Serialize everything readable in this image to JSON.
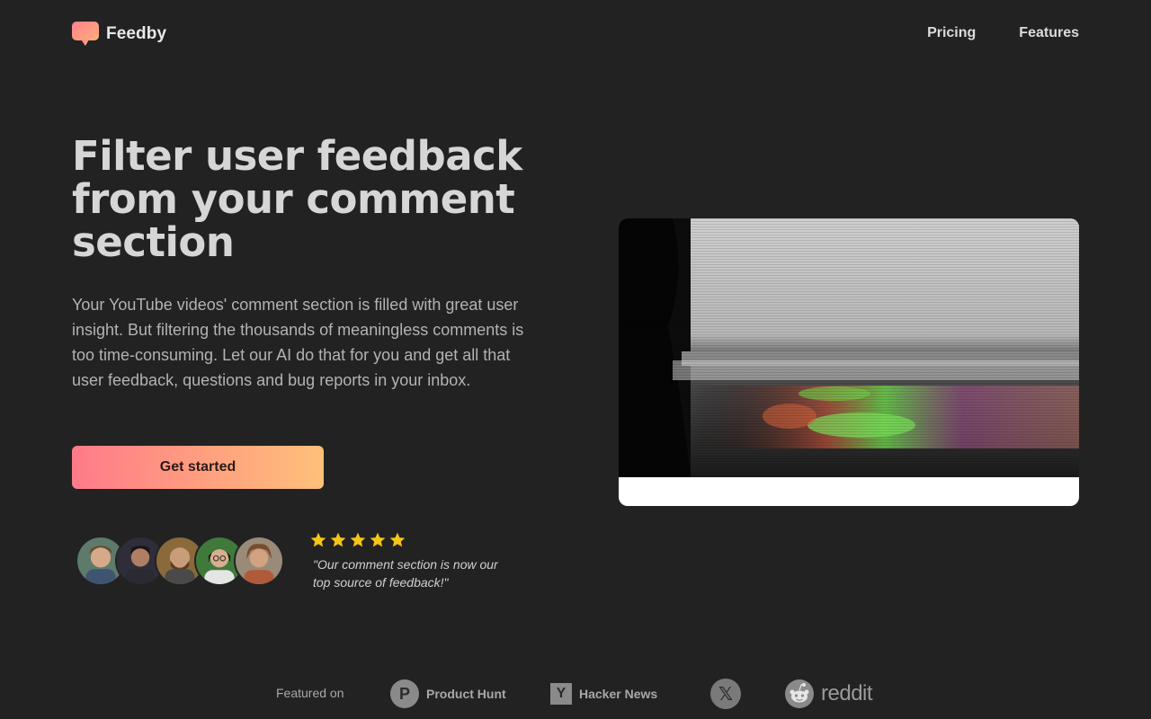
{
  "brand": {
    "name": "Feedby",
    "accent_gradient": [
      "#ff7a8a",
      "#ffc07a"
    ]
  },
  "nav": {
    "items": [
      {
        "label": "Pricing"
      },
      {
        "label": "Features"
      }
    ]
  },
  "hero": {
    "title": "Filter user feedback from your comment section",
    "description": "Your YouTube videos' comment section is filled with great user insight. But filtering the thousands of meaningless comments is too time-consuming. Let our AI do that for you and get all that user feedback, questions and bug reports in your inbox.",
    "cta_label": "Get started"
  },
  "social_proof": {
    "avatar_count": 5,
    "rating": 5,
    "star_color": "#f5c518",
    "quote": "\"Our comment section is now our top source of feedback!\""
  },
  "featured": {
    "label": "Featured on",
    "items": [
      {
        "name": "Product Hunt",
        "icon": "product-hunt-icon",
        "badge": "P"
      },
      {
        "name": "Hacker News",
        "icon": "hacker-news-icon",
        "badge": "Y"
      },
      {
        "name": "",
        "icon": "x-icon",
        "badge": "𝕏"
      },
      {
        "name": "reddit",
        "icon": "reddit-icon"
      }
    ]
  }
}
